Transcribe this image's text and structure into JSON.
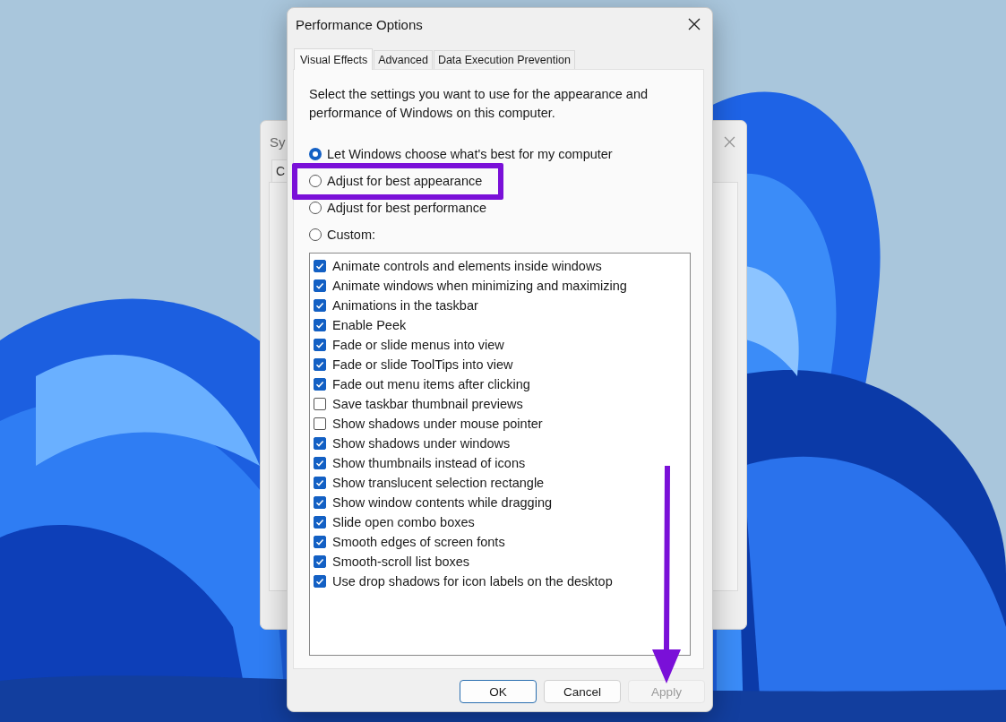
{
  "background_window": {
    "title": "Sy",
    "tab": "C"
  },
  "window": {
    "title": "Performance Options"
  },
  "tabs": [
    {
      "label": "Visual Effects",
      "selected": true
    },
    {
      "label": "Advanced",
      "selected": false
    },
    {
      "label": "Data Execution Prevention",
      "selected": false
    }
  ],
  "intro": "Select the settings you want to use for the appearance and performance of Windows on this computer.",
  "options": [
    {
      "label": "Let Windows choose what's best for my computer",
      "selected": true,
      "highlighted": false
    },
    {
      "label": "Adjust for best appearance",
      "selected": false,
      "highlighted": true
    },
    {
      "label": "Adjust for best performance",
      "selected": false,
      "highlighted": false
    },
    {
      "label": "Custom:",
      "selected": false,
      "highlighted": false
    }
  ],
  "effects": [
    {
      "label": "Animate controls and elements inside windows",
      "checked": true
    },
    {
      "label": "Animate windows when minimizing and maximizing",
      "checked": true
    },
    {
      "label": "Animations in the taskbar",
      "checked": true
    },
    {
      "label": "Enable Peek",
      "checked": true
    },
    {
      "label": "Fade or slide menus into view",
      "checked": true
    },
    {
      "label": "Fade or slide ToolTips into view",
      "checked": true
    },
    {
      "label": "Fade out menu items after clicking",
      "checked": true
    },
    {
      "label": "Save taskbar thumbnail previews",
      "checked": false
    },
    {
      "label": "Show shadows under mouse pointer",
      "checked": false
    },
    {
      "label": "Show shadows under windows",
      "checked": true
    },
    {
      "label": "Show thumbnails instead of icons",
      "checked": true
    },
    {
      "label": "Show translucent selection rectangle",
      "checked": true
    },
    {
      "label": "Show window contents while dragging",
      "checked": true
    },
    {
      "label": "Slide open combo boxes",
      "checked": true
    },
    {
      "label": "Smooth edges of screen fonts",
      "checked": true
    },
    {
      "label": "Smooth-scroll list boxes",
      "checked": true
    },
    {
      "label": "Use drop shadows for icon labels on the desktop",
      "checked": true
    }
  ],
  "buttons": [
    {
      "label": "OK",
      "default": true,
      "disabled": false
    },
    {
      "label": "Cancel",
      "default": false,
      "disabled": false
    },
    {
      "label": "Apply",
      "default": false,
      "disabled": true
    }
  ]
}
